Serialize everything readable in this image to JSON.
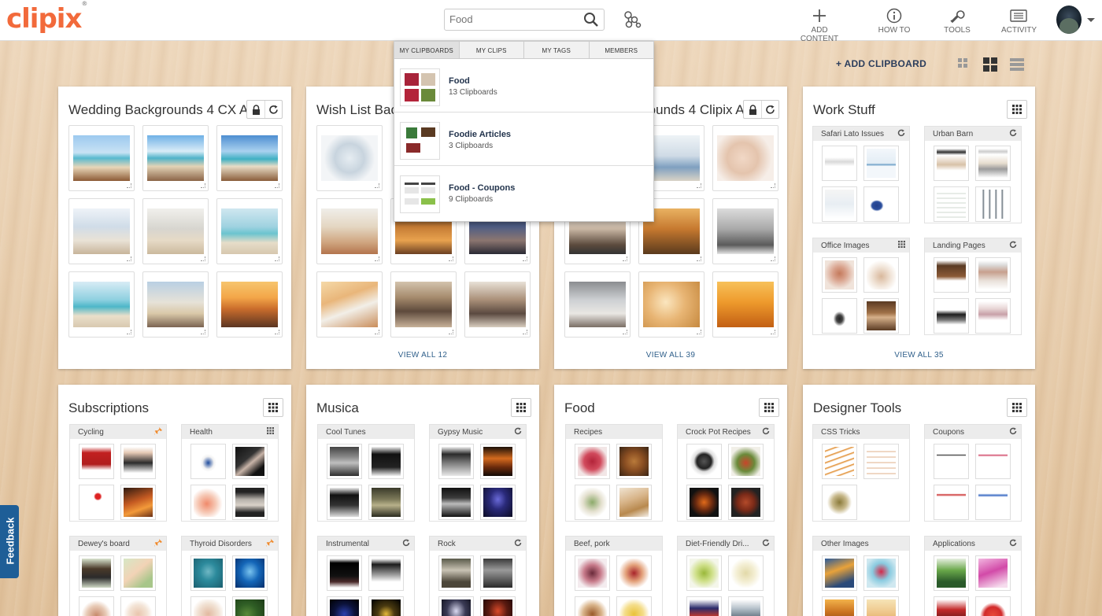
{
  "app": {
    "logo": "clipix",
    "logo_mark": "®"
  },
  "search": {
    "placeholder": "Food",
    "value": ""
  },
  "nav": {
    "add_content": "ADD CONTENT",
    "how_to": "HOW TO",
    "tools": "TOOLS",
    "activity": "ACTIVITY"
  },
  "toolbar": {
    "add_clipboard": "+ ADD CLIPBOARD"
  },
  "dropdown": {
    "tabs": [
      "MY CLIPBOARDS",
      "MY CLIPS",
      "MY TAGS",
      "MEMBERS"
    ],
    "results": [
      {
        "name": "Food",
        "count": "13 Clipboards"
      },
      {
        "name": "Foodie Articles",
        "count": "3 Clipboards"
      },
      {
        "name": "Food - Coupons",
        "count": "9 Clipboards"
      }
    ]
  },
  "boards": [
    {
      "title": "Wedding Backgrounds 4 CX AD",
      "view_all": ""
    },
    {
      "title": "Wish List Backgrounds 4 Clipix AD",
      "view_all": "VIEW ALL 12"
    },
    {
      "title": "Family Backgrounds 4 Clipix AD",
      "view_all": "VIEW ALL 39"
    },
    {
      "title": "Work Stuff",
      "view_all": "VIEW ALL 35",
      "subs": [
        "Safari Lato Issues",
        "Urban Barn",
        "Office Images",
        "Landing Pages"
      ]
    },
    {
      "title": "Subscriptions",
      "subs": [
        "Cycling",
        "Health",
        "Dewey's board",
        "Thyroid Disorders"
      ]
    },
    {
      "title": "Musica",
      "subs": [
        "Cool Tunes",
        "Gypsy Music",
        "Instrumental",
        "Rock"
      ]
    },
    {
      "title": "Food",
      "subs": [
        "Recipes",
        "Crock Pot Recipes",
        "Beef, pork",
        "Diet-Friendly Dri..."
      ]
    },
    {
      "title": "Designer Tools",
      "subs": [
        "CSS Tricks",
        "Coupons",
        "Other Images",
        "Applications"
      ]
    }
  ],
  "feedback": {
    "label": "Feedback"
  },
  "colors": {
    "accent": "#f26a3b",
    "link": "#2f5f8a",
    "feedback": "#1e5e97"
  }
}
